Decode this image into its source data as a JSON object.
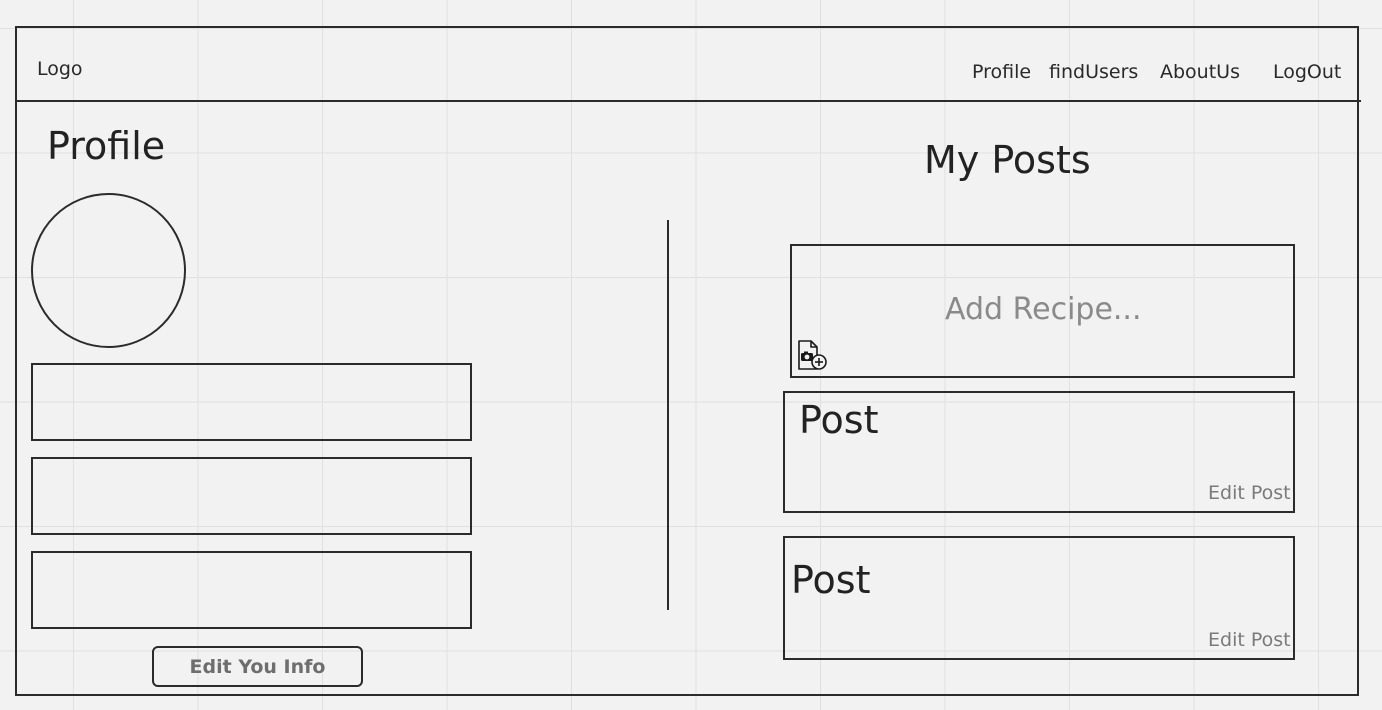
{
  "header": {
    "logo": "Logo",
    "nav": {
      "profile": "Profile",
      "find_users": "findUsers",
      "about_us": "AboutUs",
      "log_out": "LogOut"
    }
  },
  "profile": {
    "title": "Profile",
    "edit_button": "Edit You Info"
  },
  "posts": {
    "title": "My Posts",
    "add_recipe_placeholder": "Add Recipe...",
    "items": [
      {
        "title": "Post",
        "edit_label": "Edit Post"
      },
      {
        "title": "Post",
        "edit_label": "Edit Post"
      }
    ]
  },
  "icons": {
    "add_photo": "add-photo-icon"
  },
  "colors": {
    "background": "#f2f2f2",
    "stroke": "#2b2b2b",
    "muted_text": "#7a7a7a"
  }
}
